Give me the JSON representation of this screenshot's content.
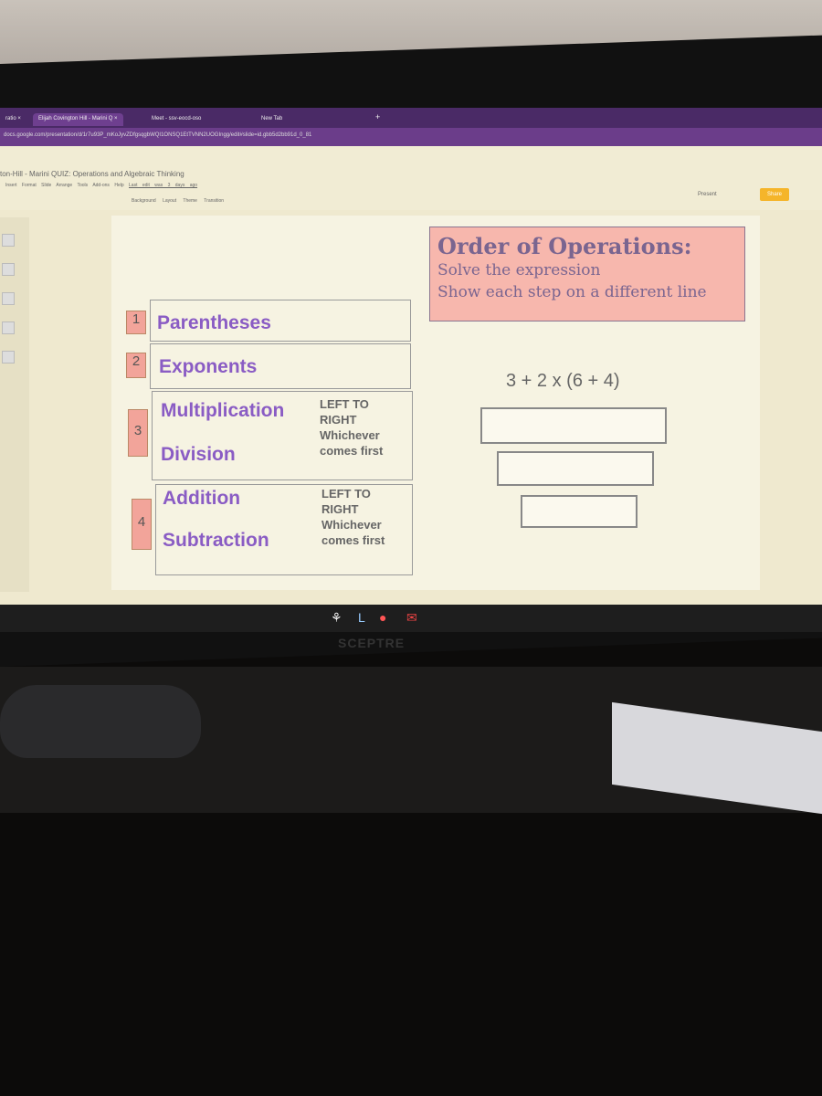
{
  "browser": {
    "tabs": [
      {
        "label": "ratio"
      },
      {
        "label": "Elijah Covington Hill - Marini Q"
      },
      {
        "label": "Meet - ssv-eocd-oso"
      },
      {
        "label": "New Tab"
      }
    ],
    "new_tab": "+",
    "url": "docs.google.com/presentation/d/1r7u93P_mKoJyvZDfgsqgbWQI1ONSQ1EtTVNN2UOGIngg/edit#slide=id.gbb5d2bb91d_0_81"
  },
  "app": {
    "doc_title": "ton-Hill - Marini QUIZ: Operations and Algebraic Thinking",
    "menu": [
      "Insert",
      "Format",
      "Slide",
      "Arrange",
      "Tools",
      "Add-ons",
      "Help"
    ],
    "last_edit": "Last edit was 3 days ago",
    "toolbar": [
      "Background",
      "Layout",
      "Theme",
      "Transition"
    ],
    "present_label": "Present",
    "share_label": "Share"
  },
  "slide": {
    "steps": [
      {
        "num": "1",
        "ops": [
          "Parentheses"
        ],
        "note": ""
      },
      {
        "num": "2",
        "ops": [
          "Exponents"
        ],
        "note": ""
      },
      {
        "num": "3",
        "ops": [
          "Multiplication",
          "Division"
        ],
        "note": "LEFT TO RIGHT Whichever comes first"
      },
      {
        "num": "4",
        "ops": [
          "Addition",
          "Subtraction"
        ],
        "note": "LEFT TO RIGHT Whichever comes first"
      }
    ],
    "instructions": {
      "title": "Order of Operations:",
      "line1": "Solve the expression",
      "line2": "Show each step on a different line"
    },
    "expression": "3 + 2 x (6 + 4)",
    "colors": {
      "number_box": "#f2a49a",
      "operation_text": "#8a5cc4",
      "instruction_box": "#f7b7ad"
    }
  },
  "monitor_brand": "SCEPTRE"
}
